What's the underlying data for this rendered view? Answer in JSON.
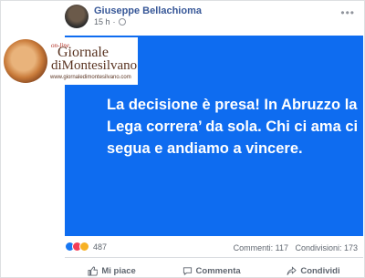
{
  "post": {
    "author": "Giuseppe Bellachioma",
    "time": "15 h",
    "text": "La decisione è presa! In Abruzzo la Lega correra’ da sola. Chi ci ama ci segua e andiamo a vincere."
  },
  "watermark": {
    "online": "on-line",
    "line1": "Giornale",
    "line2": "diMontesilvano",
    "url": "www.giornaledimontesilvano.com"
  },
  "stats": {
    "reactions_count": "487",
    "comments": "Commenti: 117",
    "shares": "Condivisioni: 173"
  },
  "actions": {
    "like": "Mi piace",
    "comment": "Commenta",
    "share": "Condividi"
  },
  "colors": {
    "banner": "#0e6cf0",
    "author_link": "#385898"
  },
  "icons": [
    "more-options-icon",
    "globe-icon",
    "like-reaction-icon",
    "love-reaction-icon",
    "wow-reaction-icon",
    "thumbs-up-icon",
    "comment-icon",
    "share-icon"
  ]
}
